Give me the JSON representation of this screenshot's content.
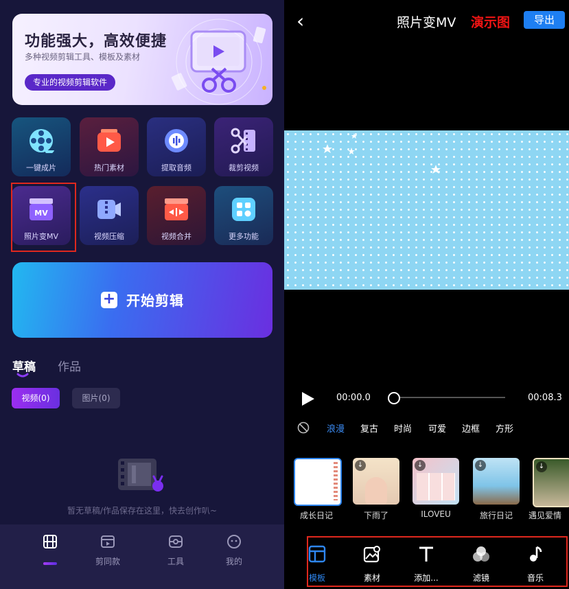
{
  "left": {
    "banner": {
      "title": "功能强大，高效便捷",
      "subtitle": "多种视频剪辑工具、模板及素材",
      "button": "专业的视频剪辑软件"
    },
    "tiles": [
      {
        "label": "一键成片",
        "icon": "film-reel-icon"
      },
      {
        "label": "热门素材",
        "icon": "play-stack-icon"
      },
      {
        "label": "提取音频",
        "icon": "audio-extract-icon"
      },
      {
        "label": "裁剪视频",
        "icon": "scissors-film-icon"
      },
      {
        "label": "照片变MV",
        "icon": "mv-clapper-icon"
      },
      {
        "label": "视频压缩",
        "icon": "zip-camera-icon"
      },
      {
        "label": "视频合并",
        "icon": "merge-clapper-icon"
      },
      {
        "label": "更多功能",
        "icon": "grid-apps-icon"
      }
    ],
    "start_button": "开始剪辑",
    "tabs": [
      "草稿",
      "作品"
    ],
    "chips": [
      "视频(0)",
      "图片(0)"
    ],
    "empty_text": "暂无草稿/作品保存在这里，快去创作叭~",
    "nav": [
      {
        "label": "",
        "icon": "film-icon",
        "active": true
      },
      {
        "label": "剪同款",
        "icon": "template-icon"
      },
      {
        "label": "工具",
        "icon": "toolbox-icon"
      },
      {
        "label": "我的",
        "icon": "profile-face-icon"
      }
    ]
  },
  "right": {
    "title": "照片变MV",
    "demo_label": "演示图",
    "export_button": "导出",
    "time_start": "00:00.0",
    "time_end": "00:08.3",
    "progress": 0.0,
    "categories": [
      "浪漫",
      "复古",
      "时尚",
      "可爱",
      "边框",
      "方形"
    ],
    "active_category": "浪漫",
    "templates": [
      {
        "label": "成长日记",
        "selected": true
      },
      {
        "label": "下雨了"
      },
      {
        "label": "ILOVEU"
      },
      {
        "label": "旅行日记"
      },
      {
        "label": "遇见爱情"
      }
    ],
    "tools": [
      {
        "label": "模板",
        "icon": "template-layout-icon",
        "active": true
      },
      {
        "label": "素材",
        "icon": "image-gear-icon"
      },
      {
        "label": "添加...",
        "icon": "text-t-icon"
      },
      {
        "label": "滤镜",
        "icon": "filter-circles-icon"
      },
      {
        "label": "音乐",
        "icon": "music-note-icon"
      }
    ]
  },
  "colors": {
    "accent_blue": "#1e7ff2",
    "highlight_red": "#e0281e",
    "left_bg": "#17163a",
    "purple": "#7a2ef0"
  }
}
